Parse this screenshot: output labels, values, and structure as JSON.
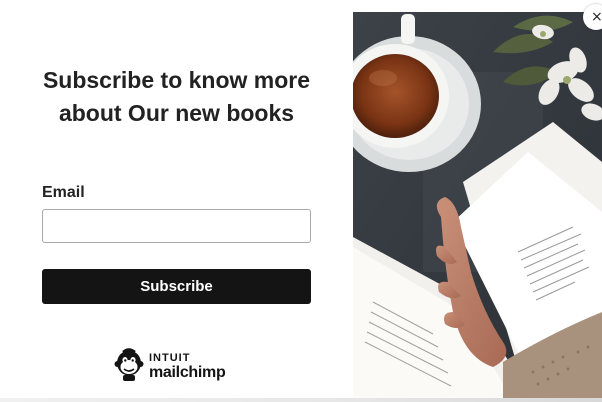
{
  "popup": {
    "headline": "Subscribe to know more about Our new books",
    "email_label": "Email",
    "email_value": "",
    "email_placeholder": "",
    "subscribe_label": "Subscribe",
    "close_label": "×"
  },
  "branding": {
    "intuit": "INTUIT",
    "mailchimp": "mailchimp",
    "logo_icon": "mailchimp-freddie-icon"
  },
  "photo": {
    "subject": "photo of a teacup, white flowers and a hand holding an open book"
  },
  "colors": {
    "button": "#141414",
    "button_text": "#ffffff",
    "text": "#222222",
    "input_border": "#a9a9a9"
  }
}
